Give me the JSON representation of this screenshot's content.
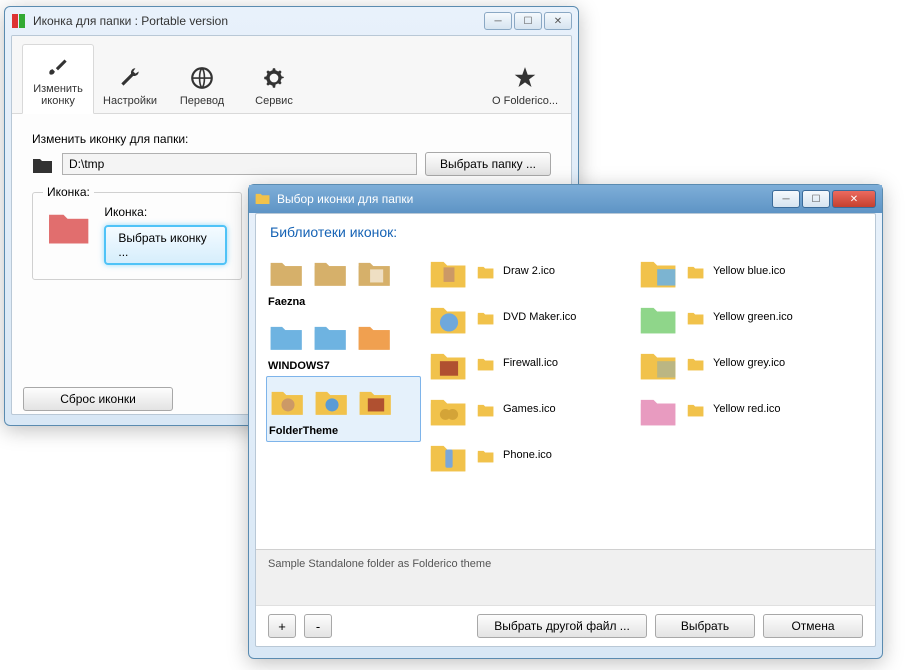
{
  "win1": {
    "title": "Иконка для папки : Portable version",
    "toolbar": {
      "change": "Изменить\nиконку",
      "settings": "Настройки",
      "translate": "Перевод",
      "service": "Сервис",
      "about": "О Folderico..."
    },
    "change_label": "Изменить иконку для папки:",
    "path_value": "D:\\tmp",
    "browse_folder": "Выбрать папку ...",
    "icon_group": "Иконка:",
    "icon_inner_label": "Иконка:",
    "choose_icon": "Выбрать иконку ...",
    "reset": "Сброс иконки"
  },
  "win2": {
    "title": "Выбор иконки для папки",
    "section": "Библиотеки иконок:",
    "libs": {
      "faezna": "Faezna",
      "win7": "WINDOWS7",
      "foldertheme": "FolderTheme"
    },
    "mid_items": [
      "Draw 2.ico",
      "DVD Maker.ico",
      "Firewall.ico",
      "Games.ico",
      "Phone.ico"
    ],
    "right_items": [
      "Yellow blue.ico",
      "Yellow green.ico",
      "Yellow grey.ico",
      "Yellow red.ico"
    ],
    "description": "Sample Standalone folder as Folderico theme",
    "add": "+",
    "remove": "-",
    "choose_other": "Выбрать другой файл ...",
    "choose": "Выбрать",
    "cancel": "Отмена"
  }
}
